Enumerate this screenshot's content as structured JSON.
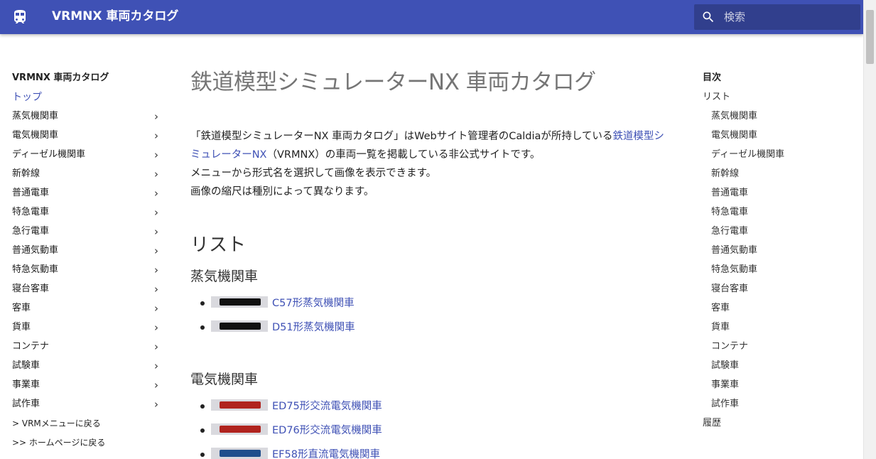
{
  "header": {
    "site_title": "VRMNX 車両カタログ",
    "search_placeholder": "検索",
    "brand_color": "#3f51b5"
  },
  "left_nav": {
    "title": "VRMNX 車両カタログ",
    "home": "トップ",
    "categories": [
      "蒸気機関車",
      "電気機関車",
      "ディーゼル機関車",
      "新幹線",
      "普通電車",
      "特急電車",
      "急行電車",
      "普通気動車",
      "特急気動車",
      "寝台客車",
      "客車",
      "貨車",
      "コンテナ",
      "試験車",
      "事業車",
      "試作車"
    ],
    "expand_icon": "chevron-right-icon",
    "back_vrm": "> VRMメニューに戻る",
    "back_home": ">> ホームページに戻る"
  },
  "main": {
    "title": "鉄道模型シミュレーターNX 車両カタログ",
    "intro": {
      "p1_before": "「鉄道模型シミュレーターNX 車両カタログ」はWebサイト管理者のCaldiaが所持している",
      "p1_link": "鉄道模型シミュレーターNX",
      "p1_after": "（VRMNX）の車両一覧を掲載している非公式サイトです。",
      "line2": "メニューから形式名を選択して画像を表示できます。",
      "line3": "画像の縮尺は種別によって異なります。"
    },
    "list_heading": "リスト",
    "sections": [
      {
        "heading": "蒸気機関車",
        "items": [
          {
            "label": "C57形蒸気機関車",
            "thumb_color": "#111111"
          },
          {
            "label": "D51形蒸気機関車",
            "thumb_color": "#111111"
          }
        ]
      },
      {
        "heading": "電気機関車",
        "items": [
          {
            "label": "ED75形交流電気機関車",
            "thumb_color": "#b0231e"
          },
          {
            "label": "ED76形交流電気機関車",
            "thumb_color": "#b0231e"
          },
          {
            "label": "EF58形直流電気機関車",
            "thumb_color": "#1f4e8c"
          }
        ]
      }
    ]
  },
  "toc": {
    "title": "目次",
    "list": "リスト",
    "items": [
      "蒸気機関車",
      "電気機関車",
      "ディーゼル機関車",
      "新幹線",
      "普通電車",
      "特急電車",
      "急行電車",
      "普通気動車",
      "特急気動車",
      "寝台客車",
      "客車",
      "貨車",
      "コンテナ",
      "試験車",
      "事業車",
      "試作車"
    ],
    "history": "履歴"
  }
}
